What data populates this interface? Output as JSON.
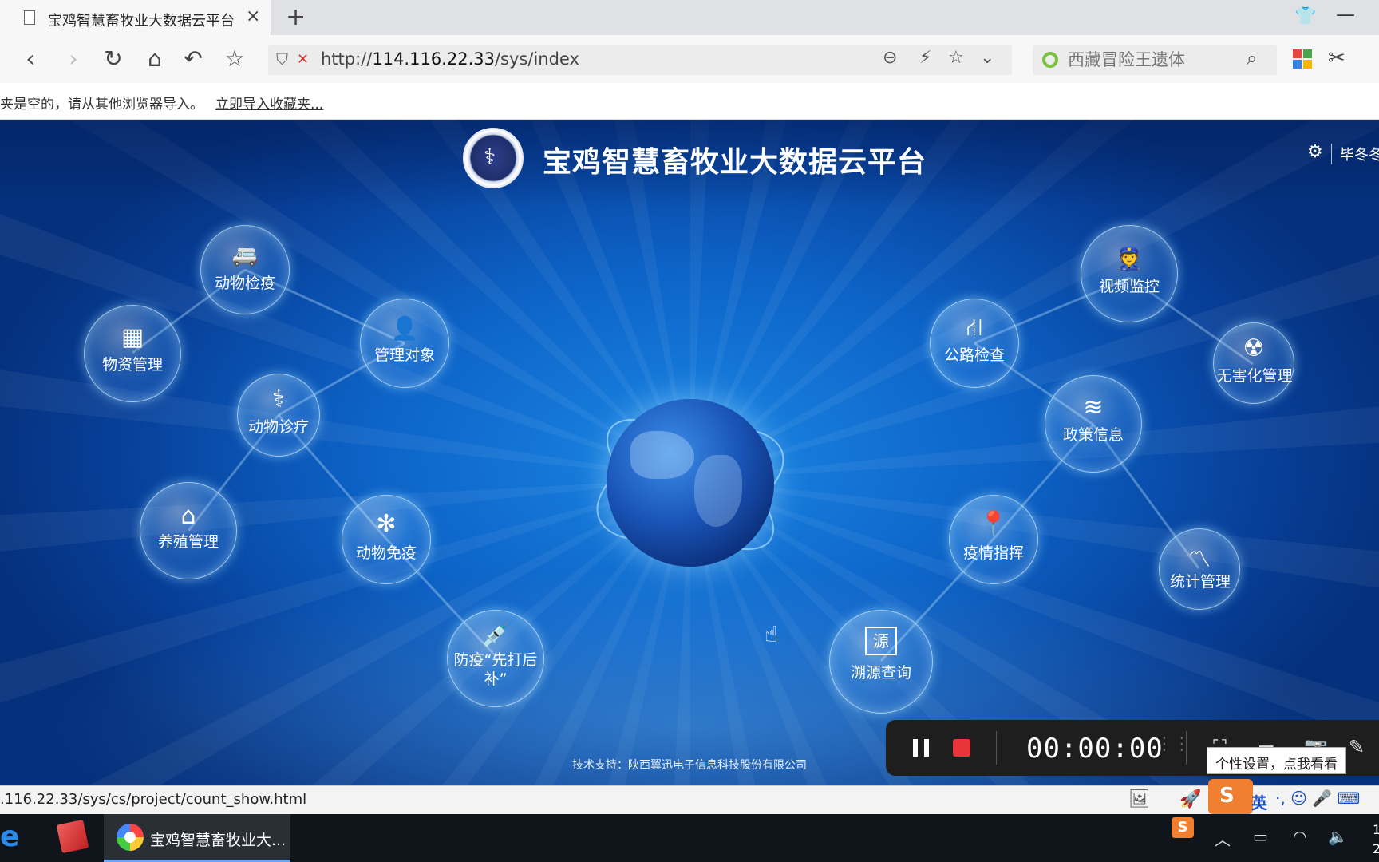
{
  "browser": {
    "tab_title": "宝鸡智慧畜牧业大数据云平台",
    "tab_close": "×",
    "new_tab": "+",
    "url_host": "114.116.22.33",
    "url_prefix": "http://",
    "url_path": "/sys/index",
    "search_placeholder": "西藏冒险王遗体",
    "bookmark_message": "夹是空的，请从其他浏览器导入。",
    "bookmark_import_link": "立即导入收藏夹..."
  },
  "page": {
    "title": "宝鸡智慧畜牧业大数据云平台",
    "user_name": "毕冬冬",
    "footer": "技术支持：陕西翼迅电子信息科技股份有限公司",
    "modules_left": [
      {
        "label": "动物检疫",
        "icon": "ambulance-icon"
      },
      {
        "label": "物资管理",
        "icon": "shelves-icon"
      },
      {
        "label": "管理对象",
        "icon": "user-gear-icon"
      },
      {
        "label": "动物诊疗",
        "icon": "stethoscope-icon"
      },
      {
        "label": "养殖管理",
        "icon": "barn-icon"
      },
      {
        "label": "动物免疫",
        "icon": "molecule-icon"
      },
      {
        "label": "防疫“先打后补”",
        "icon": "syringe-icon"
      }
    ],
    "modules_right": [
      {
        "label": "视频监控",
        "icon": "officer-icon"
      },
      {
        "label": "公路检查",
        "icon": "road-icon"
      },
      {
        "label": "无害化管理",
        "icon": "radiation-icon"
      },
      {
        "label": "政策信息",
        "icon": "layers-icon"
      },
      {
        "label": "疫情指挥",
        "icon": "map-pin-icon"
      },
      {
        "label": "统计管理",
        "icon": "line-chart-icon"
      },
      {
        "label": "溯源查询",
        "icon": "source-icon"
      }
    ],
    "source_badge": "源"
  },
  "recorder": {
    "timer": "00:00:00",
    "tooltip": "个性设置，点我看看"
  },
  "statusbar": {
    "hover_url": ".116.22.33/sys/cs/project/count_show.html",
    "ime_lang": "英"
  },
  "taskbar": {
    "active_task": "宝鸡智慧畜牧业大...",
    "clock_line1": "1",
    "clock_line2": "2"
  }
}
